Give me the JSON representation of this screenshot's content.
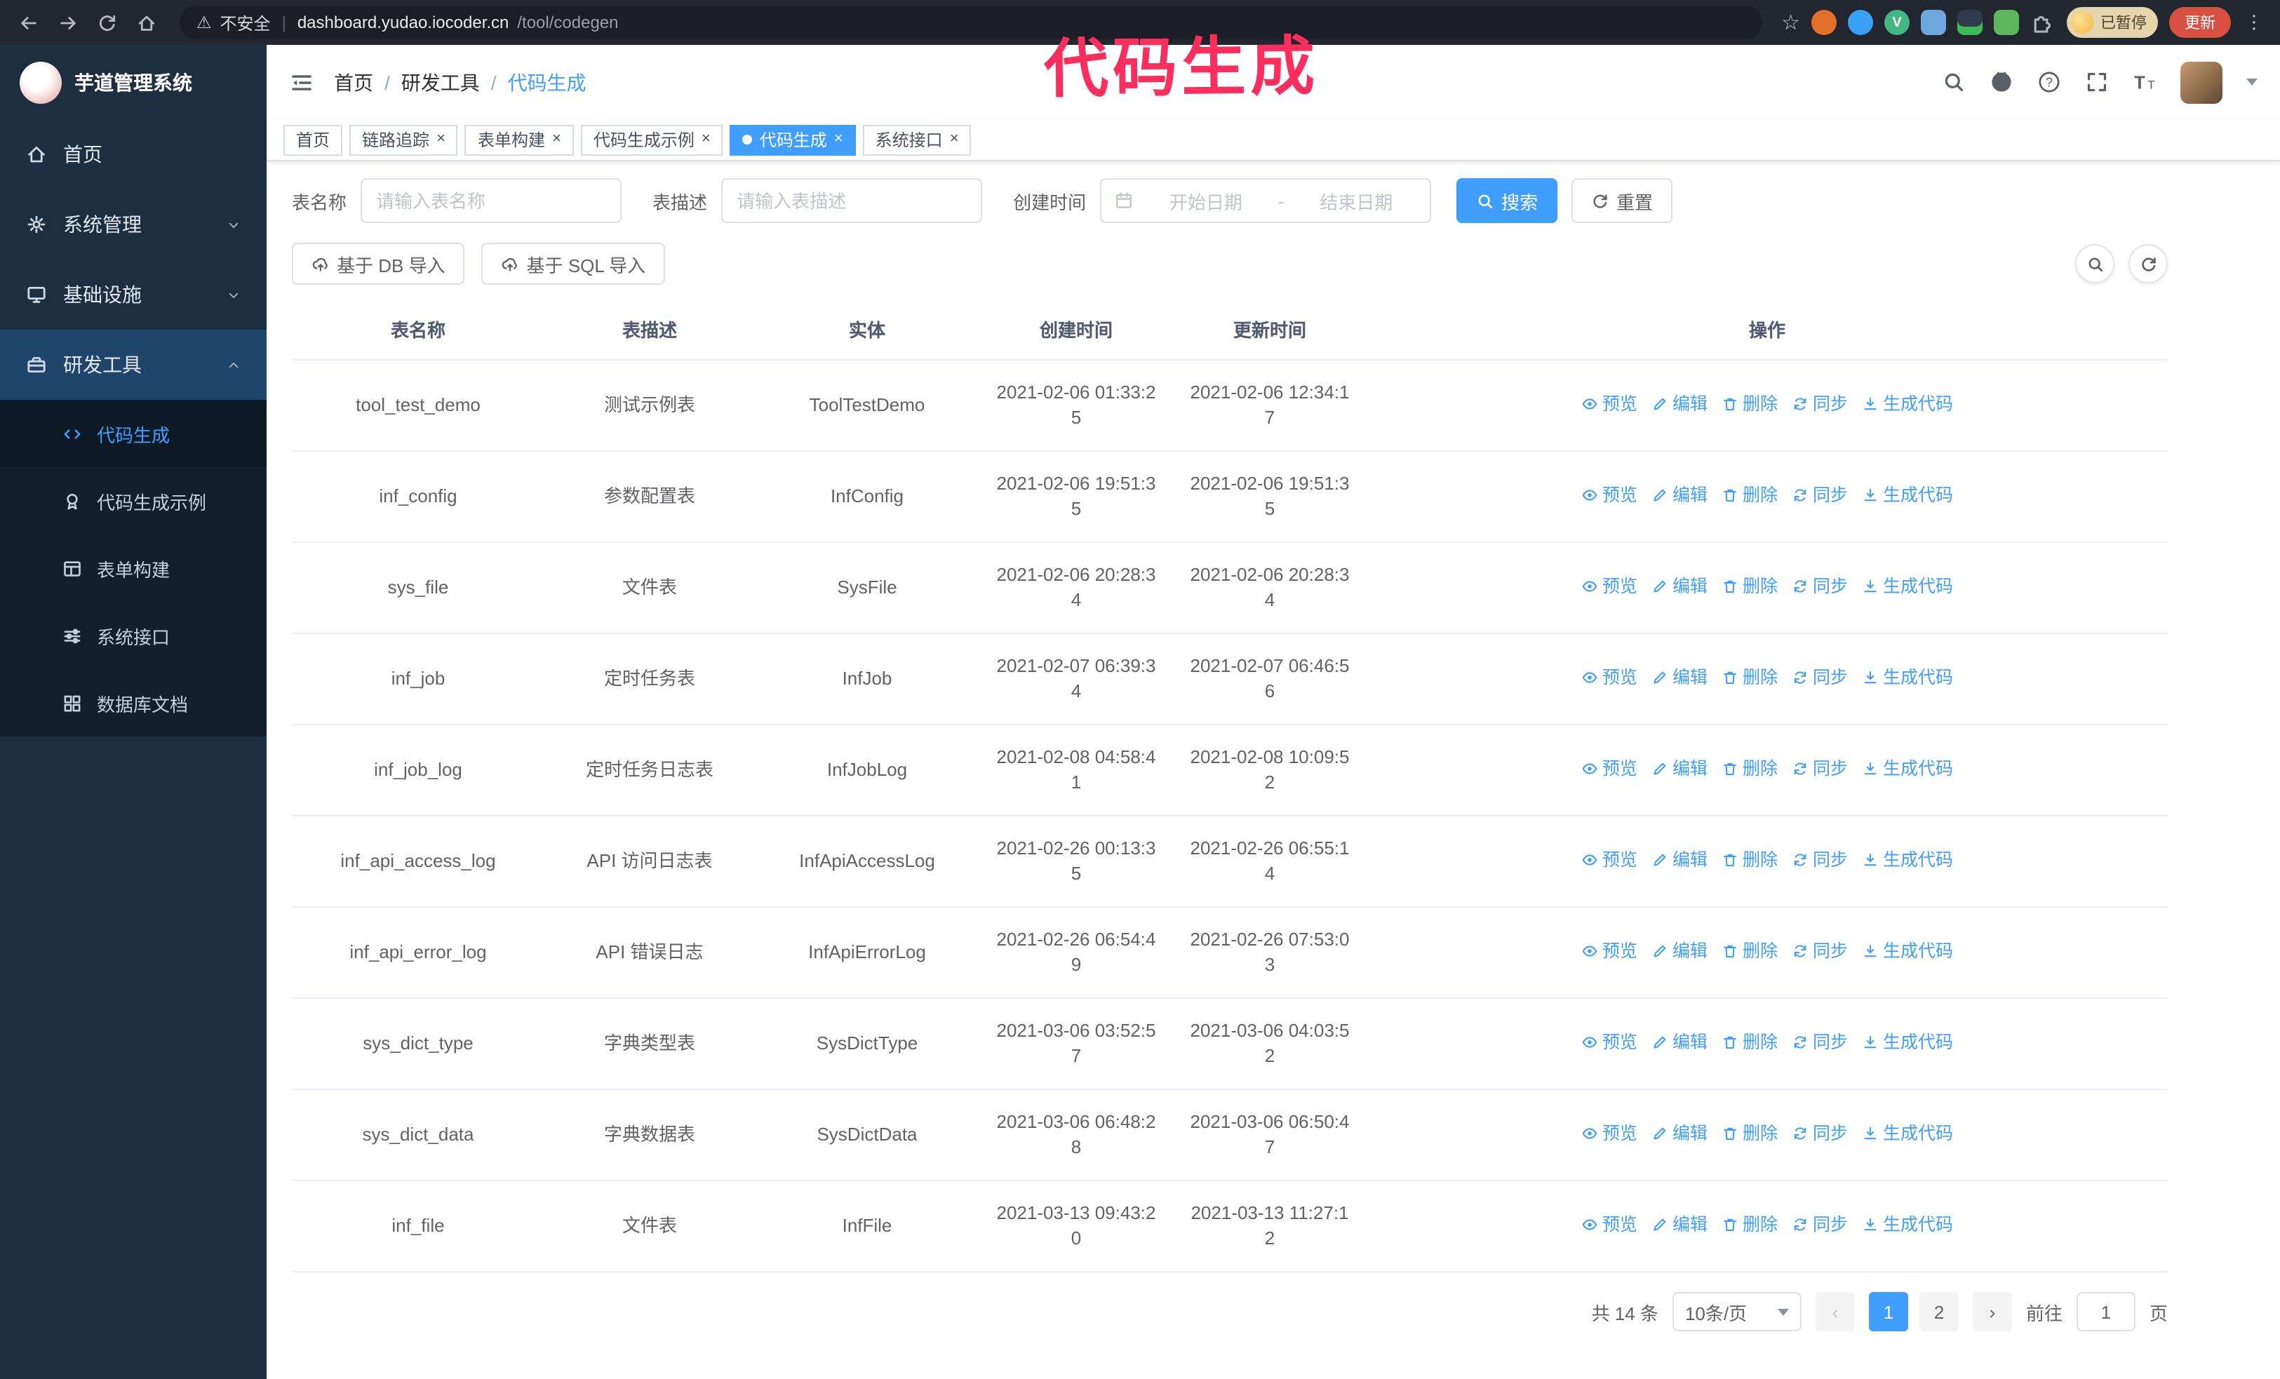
{
  "annotation": "代码生成",
  "browser": {
    "security_label": "不安全",
    "url_host": "dashboard.yudao.iocoder.cn",
    "url_path": "/tool/codegen",
    "profile_badge": "已暂停",
    "update_button": "更新"
  },
  "sidebar": {
    "logo_title": "芋道管理系统",
    "menu": [
      {
        "key": "home",
        "label": "首页",
        "icon": "home"
      },
      {
        "key": "system",
        "label": "系统管理",
        "icon": "gear",
        "chevron": "down"
      },
      {
        "key": "infra",
        "label": "基础设施",
        "icon": "monitor",
        "chevron": "down"
      },
      {
        "key": "dev-tools",
        "label": "研发工具",
        "icon": "tools",
        "chevron": "up",
        "open": true,
        "children": [
          {
            "key": "codegen",
            "label": "代码生成",
            "icon": "code",
            "active": true
          },
          {
            "key": "codegen-example",
            "label": "代码生成示例",
            "icon": "medal"
          },
          {
            "key": "form-builder",
            "label": "表单构建",
            "icon": "form"
          },
          {
            "key": "api",
            "label": "系统接口",
            "icon": "sliders"
          },
          {
            "key": "db-doc",
            "label": "数据库文档",
            "icon": "grid"
          }
        ]
      }
    ]
  },
  "header": {
    "breadcrumb": [
      "首页",
      "研发工具",
      "代码生成"
    ]
  },
  "tabs": [
    {
      "label": "首页",
      "closable": false,
      "active": false
    },
    {
      "label": "链路追踪",
      "closable": true,
      "active": false
    },
    {
      "label": "表单构建",
      "closable": true,
      "active": false
    },
    {
      "label": "代码生成示例",
      "closable": true,
      "active": false
    },
    {
      "label": "代码生成",
      "closable": true,
      "active": true
    },
    {
      "label": "系统接口",
      "closable": true,
      "active": false
    }
  ],
  "filters": {
    "table_name_label": "表名称",
    "table_name_placeholder": "请输入表名称",
    "table_desc_label": "表描述",
    "table_desc_placeholder": "请输入表描述",
    "create_time_label": "创建时间",
    "start_placeholder": "开始日期",
    "range_separator": "-",
    "end_placeholder": "结束日期",
    "search_label": "搜索",
    "reset_label": "重置"
  },
  "toolbar": {
    "import_db_label": "基于 DB 导入",
    "import_sql_label": "基于 SQL 导入"
  },
  "table": {
    "columns": [
      "表名称",
      "表描述",
      "实体",
      "创建时间",
      "更新时间",
      "操作"
    ],
    "actions": [
      {
        "key": "preview",
        "label": "预览",
        "icon": "eye"
      },
      {
        "key": "edit",
        "label": "编辑",
        "icon": "edit"
      },
      {
        "key": "delete",
        "label": "删除",
        "icon": "delete"
      },
      {
        "key": "sync",
        "label": "同步",
        "icon": "sync"
      },
      {
        "key": "generate",
        "label": "生成代码",
        "icon": "download"
      }
    ],
    "rows": [
      {
        "name": "tool_test_demo",
        "desc": "测试示例表",
        "entity": "ToolTestDemo",
        "created": "2021-02-06 01:33:25",
        "updated": "2021-02-06 12:34:17"
      },
      {
        "name": "inf_config",
        "desc": "参数配置表",
        "entity": "InfConfig",
        "created": "2021-02-06 19:51:35",
        "updated": "2021-02-06 19:51:35"
      },
      {
        "name": "sys_file",
        "desc": "文件表",
        "entity": "SysFile",
        "created": "2021-02-06 20:28:34",
        "updated": "2021-02-06 20:28:34"
      },
      {
        "name": "inf_job",
        "desc": "定时任务表",
        "entity": "InfJob",
        "created": "2021-02-07 06:39:34",
        "updated": "2021-02-07 06:46:56"
      },
      {
        "name": "inf_job_log",
        "desc": "定时任务日志表",
        "entity": "InfJobLog",
        "created": "2021-02-08 04:58:41",
        "updated": "2021-02-08 10:09:52"
      },
      {
        "name": "inf_api_access_log",
        "desc": "API 访问日志表",
        "entity": "InfApiAccessLog",
        "created": "2021-02-26 00:13:35",
        "updated": "2021-02-26 06:55:14"
      },
      {
        "name": "inf_api_error_log",
        "desc": "API 错误日志",
        "entity": "InfApiErrorLog",
        "created": "2021-02-26 06:54:49",
        "updated": "2021-02-26 07:53:03"
      },
      {
        "name": "sys_dict_type",
        "desc": "字典类型表",
        "entity": "SysDictType",
        "created": "2021-03-06 03:52:57",
        "updated": "2021-03-06 04:03:52"
      },
      {
        "name": "sys_dict_data",
        "desc": "字典数据表",
        "entity": "SysDictData",
        "created": "2021-03-06 06:48:28",
        "updated": "2021-03-06 06:50:47"
      },
      {
        "name": "inf_file",
        "desc": "文件表",
        "entity": "InfFile",
        "created": "2021-03-13 09:43:20",
        "updated": "2021-03-13 11:27:12"
      }
    ]
  },
  "pagination": {
    "total_text": "共 14 条",
    "page_size": "10条/页",
    "prev_label": "‹",
    "next_label": "›",
    "pages": [
      {
        "label": "1",
        "active": true
      },
      {
        "label": "2",
        "active": false
      }
    ],
    "goto_label": "前往",
    "goto_value": "1",
    "goto_suffix": "页"
  },
  "colors": {
    "accent": "#409eff",
    "annotation": "#fb2e5e",
    "sidebar_bg": "#1d2e40",
    "submenu_bg": "#131f2d"
  }
}
